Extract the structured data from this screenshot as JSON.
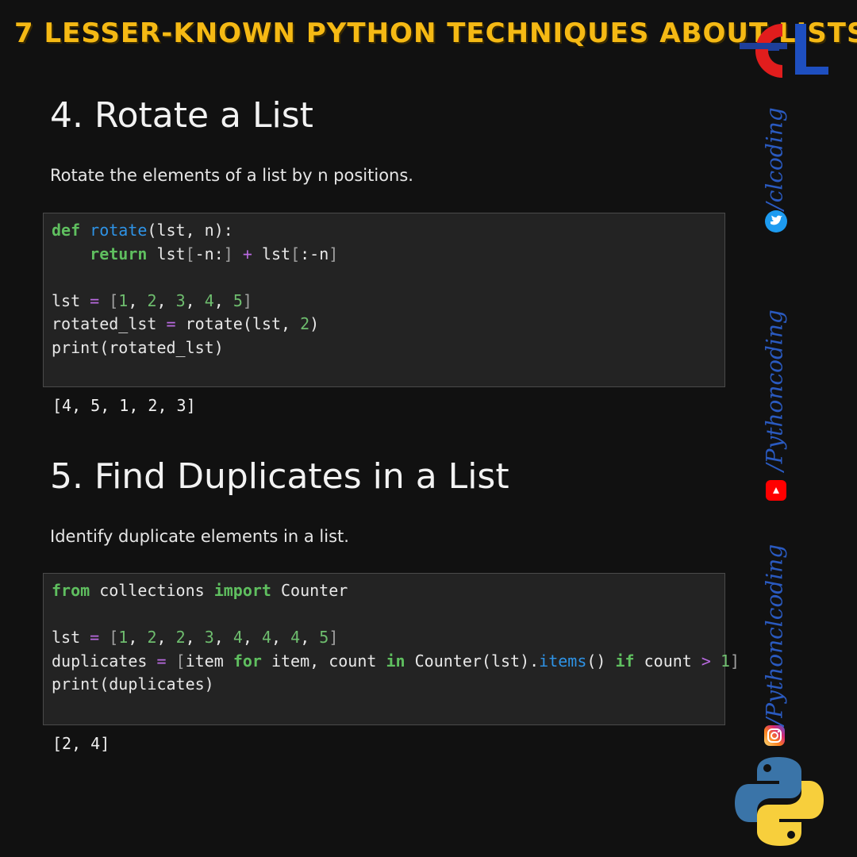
{
  "banner": {
    "title": "7 LESSER-KNOWN PYTHON TECHNIQUES ABOUT LISTS"
  },
  "section4": {
    "heading": "4. Rotate a List",
    "description": "Rotate the elements of a list by n positions.",
    "code": {
      "l1_def": "def",
      "l1_fn": "rotate",
      "l1_rest": "(lst, n):",
      "l2_indent": "    ",
      "l2_kw": "return",
      "l2_a": " lst",
      "l2_b": "[",
      "l2_c": "-n:",
      "l2_d": "]",
      "l2_plus": " + ",
      "l2_e": "lst",
      "l2_f": "[",
      "l2_g": ":-n",
      "l2_h": "]",
      "l4_a": "lst",
      "l4_eq": " = ",
      "l4_ob": "[",
      "l4_n1": "1",
      "l4_s1": ", ",
      "l4_n2": "2",
      "l4_s2": ", ",
      "l4_n3": "3",
      "l4_s3": ", ",
      "l4_n4": "4",
      "l4_s4": ", ",
      "l4_n5": "5",
      "l4_cb": "]",
      "l5_a": "rotated_lst",
      "l5_eq": " = ",
      "l5_b": "rotate(lst, ",
      "l5_n": "2",
      "l5_c": ")",
      "l6": "print(rotated_lst)"
    },
    "output": "[4, 5, 1, 2, 3]"
  },
  "section5": {
    "heading": "5. Find Duplicates in a List",
    "description": "Identify duplicate elements in a list.",
    "code": {
      "l1_from": "from",
      "l1_mod": " collections ",
      "l1_imp": "import",
      "l1_name": " Counter",
      "l3_a": "lst",
      "l3_eq": " = ",
      "l3_ob": "[",
      "l3_n1": "1",
      "l3_s1": ", ",
      "l3_n2": "2",
      "l3_s2": ", ",
      "l3_n3": "2",
      "l3_s3": ", ",
      "l3_n4": "3",
      "l3_s4": ", ",
      "l3_n5": "4",
      "l3_s5": ", ",
      "l3_n6": "4",
      "l3_s6": ", ",
      "l3_n7": "4",
      "l3_s7": ", ",
      "l3_n8": "5",
      "l3_cb": "]",
      "l4_a": "duplicates",
      "l4_eq": " = ",
      "l4_ob": "[",
      "l4_b": "item ",
      "l4_for": "for",
      "l4_c": " item, count ",
      "l4_in": "in",
      "l4_d": " Counter(lst).",
      "l4_items": "items",
      "l4_e": "() ",
      "l4_if": "if",
      "l4_f": " count ",
      "l4_gt": ">",
      "l4_sp": " ",
      "l4_one": "1",
      "l4_cb": "]",
      "l5": "print(duplicates)"
    },
    "output": "[2, 4]"
  },
  "social": {
    "twitter": "/clcoding",
    "youtube": "/Pythoncoding",
    "instagram": "/Pythonclcoding"
  },
  "colors": {
    "banner": "#f5b914",
    "keyword": "#5fbf5f",
    "function": "#2e93e6",
    "operator": "#b86adf",
    "side_text": "#2a5ac0"
  },
  "icons": [
    "cl-logo-icon",
    "twitter-icon",
    "youtube-icon",
    "instagram-icon",
    "python-logo-icon"
  ]
}
